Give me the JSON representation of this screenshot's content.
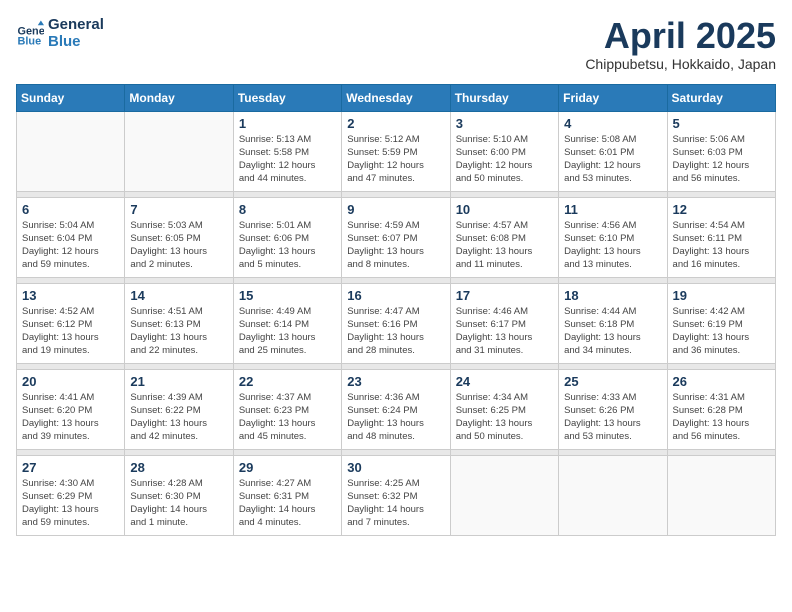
{
  "header": {
    "logo_text_general": "General",
    "logo_text_blue": "Blue",
    "title": "April 2025",
    "location": "Chippubetsu, Hokkaido, Japan"
  },
  "weekdays": [
    "Sunday",
    "Monday",
    "Tuesday",
    "Wednesday",
    "Thursday",
    "Friday",
    "Saturday"
  ],
  "weeks": [
    [
      {
        "day": "",
        "info": ""
      },
      {
        "day": "",
        "info": ""
      },
      {
        "day": "1",
        "info": "Sunrise: 5:13 AM\nSunset: 5:58 PM\nDaylight: 12 hours\nand 44 minutes."
      },
      {
        "day": "2",
        "info": "Sunrise: 5:12 AM\nSunset: 5:59 PM\nDaylight: 12 hours\nand 47 minutes."
      },
      {
        "day": "3",
        "info": "Sunrise: 5:10 AM\nSunset: 6:00 PM\nDaylight: 12 hours\nand 50 minutes."
      },
      {
        "day": "4",
        "info": "Sunrise: 5:08 AM\nSunset: 6:01 PM\nDaylight: 12 hours\nand 53 minutes."
      },
      {
        "day": "5",
        "info": "Sunrise: 5:06 AM\nSunset: 6:03 PM\nDaylight: 12 hours\nand 56 minutes."
      }
    ],
    [
      {
        "day": "6",
        "info": "Sunrise: 5:04 AM\nSunset: 6:04 PM\nDaylight: 12 hours\nand 59 minutes."
      },
      {
        "day": "7",
        "info": "Sunrise: 5:03 AM\nSunset: 6:05 PM\nDaylight: 13 hours\nand 2 minutes."
      },
      {
        "day": "8",
        "info": "Sunrise: 5:01 AM\nSunset: 6:06 PM\nDaylight: 13 hours\nand 5 minutes."
      },
      {
        "day": "9",
        "info": "Sunrise: 4:59 AM\nSunset: 6:07 PM\nDaylight: 13 hours\nand 8 minutes."
      },
      {
        "day": "10",
        "info": "Sunrise: 4:57 AM\nSunset: 6:08 PM\nDaylight: 13 hours\nand 11 minutes."
      },
      {
        "day": "11",
        "info": "Sunrise: 4:56 AM\nSunset: 6:10 PM\nDaylight: 13 hours\nand 13 minutes."
      },
      {
        "day": "12",
        "info": "Sunrise: 4:54 AM\nSunset: 6:11 PM\nDaylight: 13 hours\nand 16 minutes."
      }
    ],
    [
      {
        "day": "13",
        "info": "Sunrise: 4:52 AM\nSunset: 6:12 PM\nDaylight: 13 hours\nand 19 minutes."
      },
      {
        "day": "14",
        "info": "Sunrise: 4:51 AM\nSunset: 6:13 PM\nDaylight: 13 hours\nand 22 minutes."
      },
      {
        "day": "15",
        "info": "Sunrise: 4:49 AM\nSunset: 6:14 PM\nDaylight: 13 hours\nand 25 minutes."
      },
      {
        "day": "16",
        "info": "Sunrise: 4:47 AM\nSunset: 6:16 PM\nDaylight: 13 hours\nand 28 minutes."
      },
      {
        "day": "17",
        "info": "Sunrise: 4:46 AM\nSunset: 6:17 PM\nDaylight: 13 hours\nand 31 minutes."
      },
      {
        "day": "18",
        "info": "Sunrise: 4:44 AM\nSunset: 6:18 PM\nDaylight: 13 hours\nand 34 minutes."
      },
      {
        "day": "19",
        "info": "Sunrise: 4:42 AM\nSunset: 6:19 PM\nDaylight: 13 hours\nand 36 minutes."
      }
    ],
    [
      {
        "day": "20",
        "info": "Sunrise: 4:41 AM\nSunset: 6:20 PM\nDaylight: 13 hours\nand 39 minutes."
      },
      {
        "day": "21",
        "info": "Sunrise: 4:39 AM\nSunset: 6:22 PM\nDaylight: 13 hours\nand 42 minutes."
      },
      {
        "day": "22",
        "info": "Sunrise: 4:37 AM\nSunset: 6:23 PM\nDaylight: 13 hours\nand 45 minutes."
      },
      {
        "day": "23",
        "info": "Sunrise: 4:36 AM\nSunset: 6:24 PM\nDaylight: 13 hours\nand 48 minutes."
      },
      {
        "day": "24",
        "info": "Sunrise: 4:34 AM\nSunset: 6:25 PM\nDaylight: 13 hours\nand 50 minutes."
      },
      {
        "day": "25",
        "info": "Sunrise: 4:33 AM\nSunset: 6:26 PM\nDaylight: 13 hours\nand 53 minutes."
      },
      {
        "day": "26",
        "info": "Sunrise: 4:31 AM\nSunset: 6:28 PM\nDaylight: 13 hours\nand 56 minutes."
      }
    ],
    [
      {
        "day": "27",
        "info": "Sunrise: 4:30 AM\nSunset: 6:29 PM\nDaylight: 13 hours\nand 59 minutes."
      },
      {
        "day": "28",
        "info": "Sunrise: 4:28 AM\nSunset: 6:30 PM\nDaylight: 14 hours\nand 1 minute."
      },
      {
        "day": "29",
        "info": "Sunrise: 4:27 AM\nSunset: 6:31 PM\nDaylight: 14 hours\nand 4 minutes."
      },
      {
        "day": "30",
        "info": "Sunrise: 4:25 AM\nSunset: 6:32 PM\nDaylight: 14 hours\nand 7 minutes."
      },
      {
        "day": "",
        "info": ""
      },
      {
        "day": "",
        "info": ""
      },
      {
        "day": "",
        "info": ""
      }
    ]
  ]
}
